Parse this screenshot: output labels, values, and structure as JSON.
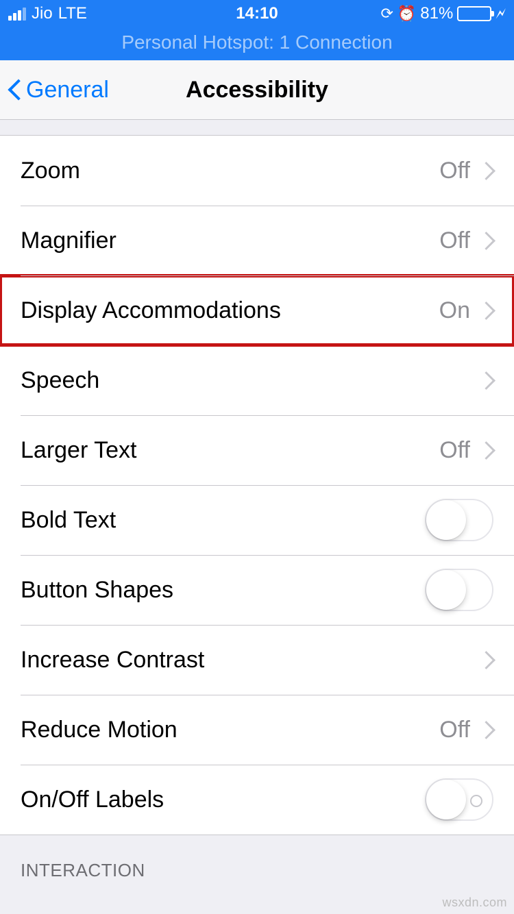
{
  "status": {
    "carrier": "Jio",
    "network": "LTE",
    "time": "14:10",
    "battery_pct": "81%",
    "lock_icon": "⊕",
    "alarm_icon": "⏰",
    "bolt_icon": "⚡"
  },
  "hotspot": {
    "text": "Personal Hotspot: 1 Connection"
  },
  "nav": {
    "back_label": "General",
    "title": "Accessibility"
  },
  "rows": {
    "zoom": {
      "label": "Zoom",
      "value": "Off"
    },
    "magnifier": {
      "label": "Magnifier",
      "value": "Off"
    },
    "display_accommodations": {
      "label": "Display Accommodations",
      "value": "On"
    },
    "speech": {
      "label": "Speech",
      "value": ""
    },
    "larger_text": {
      "label": "Larger Text",
      "value": "Off"
    },
    "bold_text": {
      "label": "Bold Text"
    },
    "button_shapes": {
      "label": "Button Shapes"
    },
    "increase_contrast": {
      "label": "Increase Contrast",
      "value": ""
    },
    "reduce_motion": {
      "label": "Reduce Motion",
      "value": "Off"
    },
    "onoff_labels": {
      "label": "On/Off Labels"
    }
  },
  "section": {
    "interaction": "INTERACTION"
  },
  "watermark": "wsxdn.com"
}
